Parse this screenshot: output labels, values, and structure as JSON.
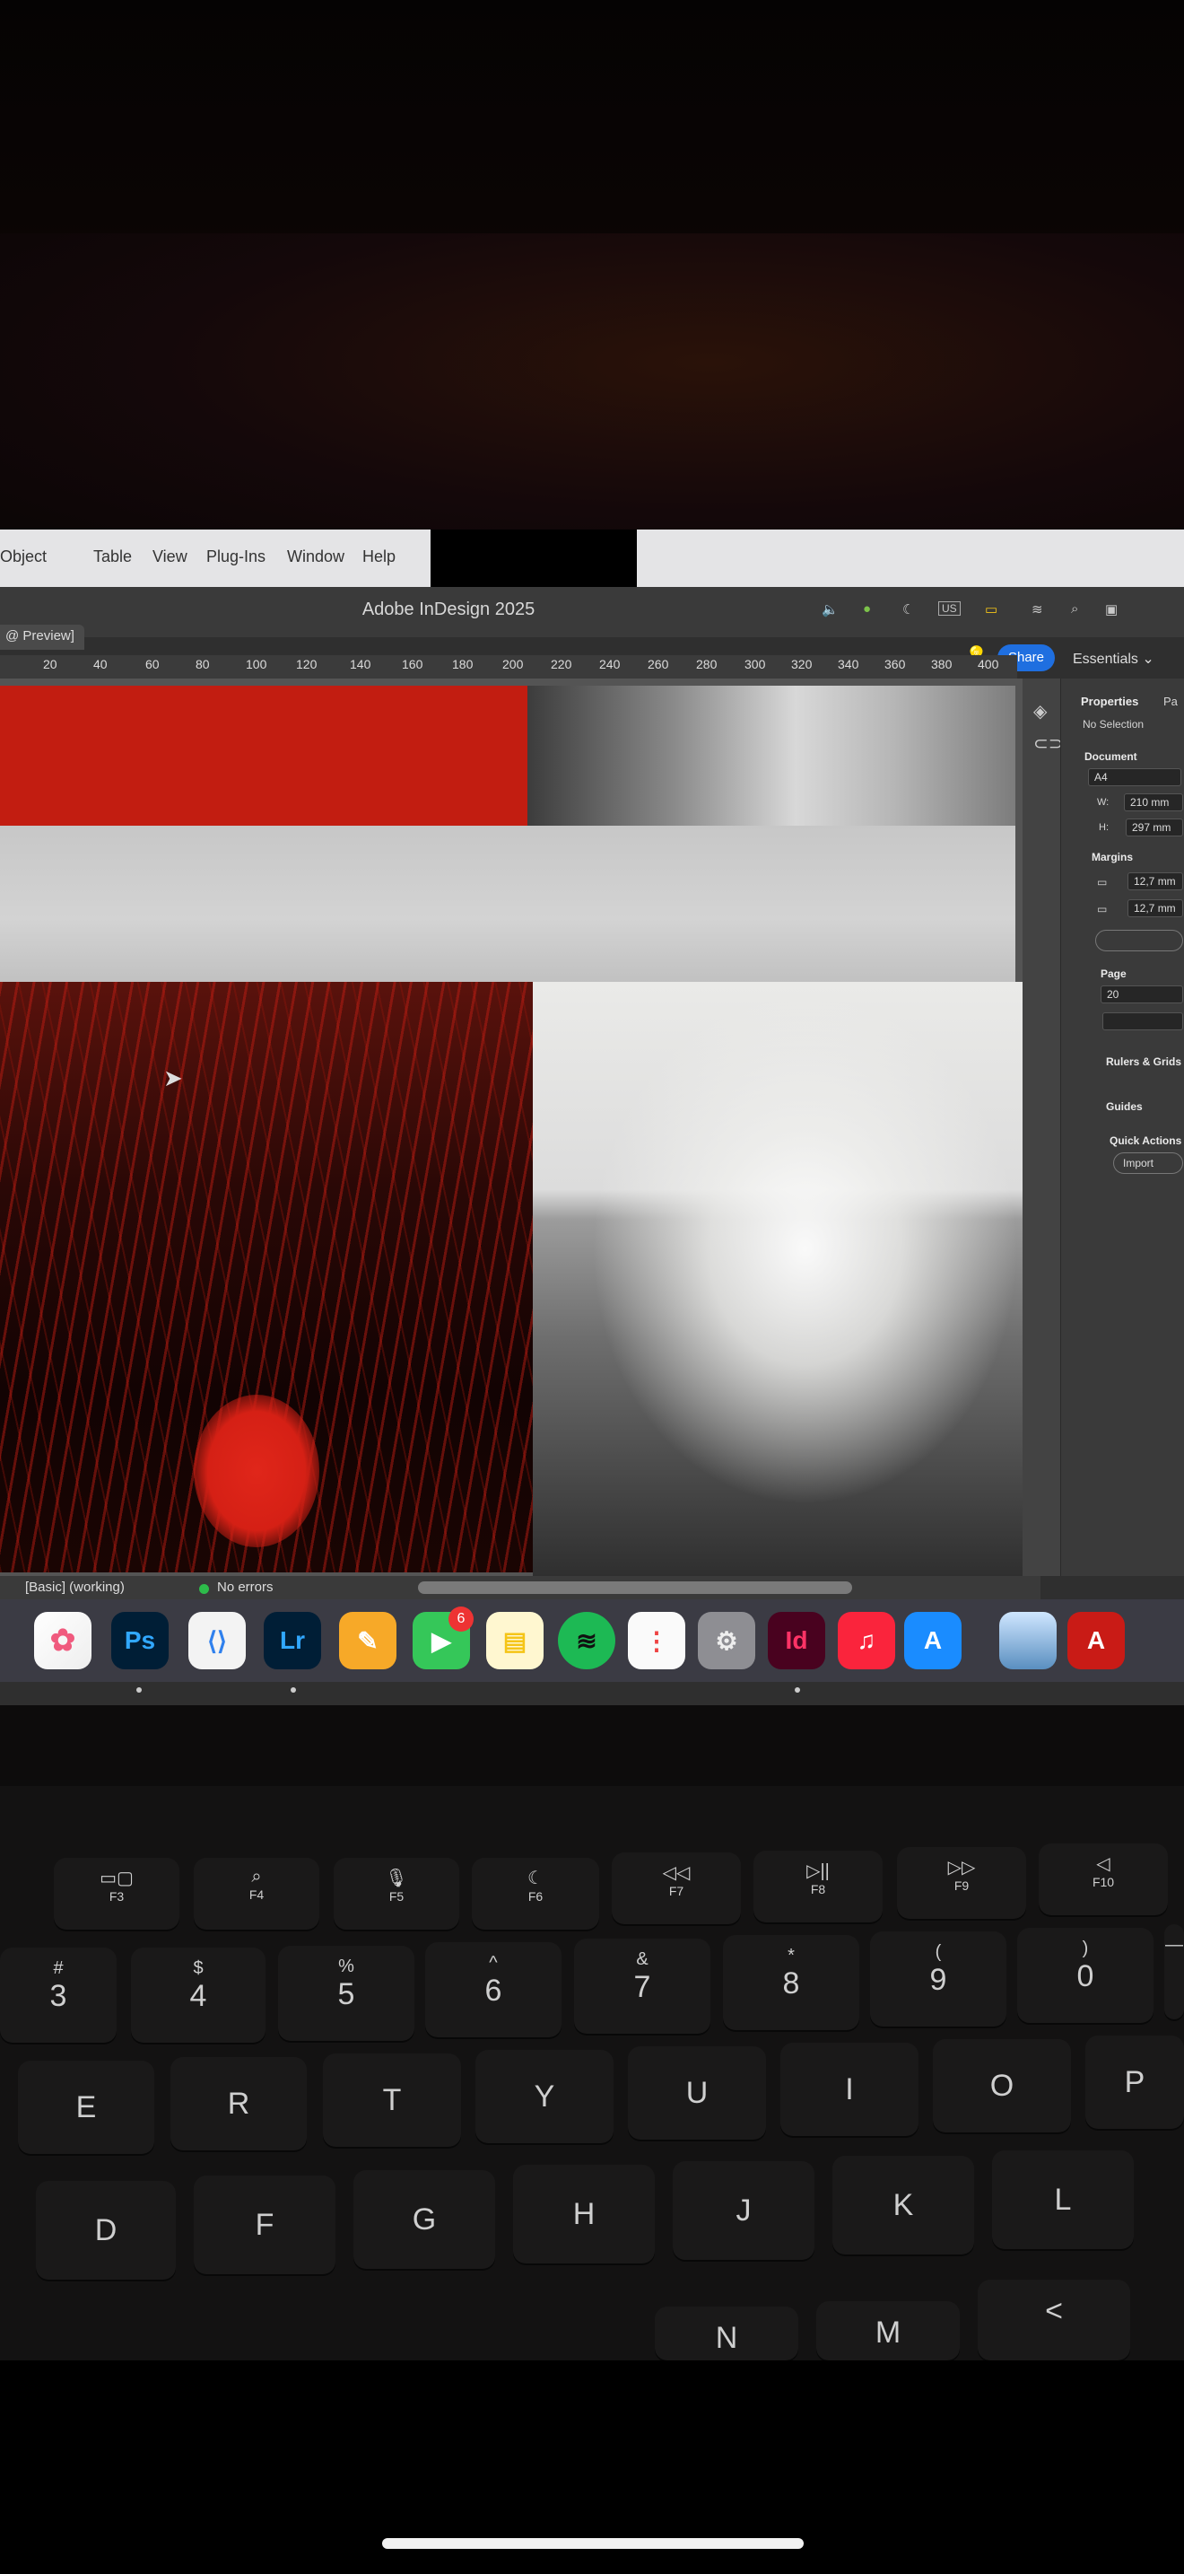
{
  "menubar": {
    "items": [
      "Object",
      "Table",
      "View",
      "Plug-Ins",
      "Window",
      "Help"
    ],
    "status_icons": [
      "volume-icon",
      "android-icon",
      "moon-icon",
      "battery-icon",
      "wifi-icon",
      "search-icon",
      "control-center-icon"
    ],
    "input_source": "US"
  },
  "window": {
    "title": "Adobe InDesign 2025",
    "doc_tab": "@ Preview]",
    "share_label": "Share",
    "workspace_label": "Essentials"
  },
  "ruler": {
    "ticks": [
      "20",
      "40",
      "60",
      "80",
      "100",
      "120",
      "140",
      "160",
      "180",
      "200",
      "220",
      "240",
      "260",
      "280",
      "300",
      "320",
      "340",
      "360",
      "380",
      "400"
    ]
  },
  "status_bar": {
    "profile": "[Basic] (working)",
    "errors": "No errors"
  },
  "properties_panel": {
    "tab_active": "Properties",
    "tab_other": "Pa",
    "selection": "No Selection",
    "document_label": "Document",
    "page_size": "A4",
    "width_label": "W:",
    "width": "210 mm",
    "height_label": "H:",
    "height": "297 mm",
    "margins_label": "Margins",
    "margin_top": "12,7 mm",
    "margin_bottom": "12,7 mm",
    "page_label": "Page",
    "page_value": "20",
    "rulers_grids": "Rulers & Grids",
    "guides": "Guides",
    "quick_actions": "Quick Actions",
    "import_label": "Import"
  },
  "dock": {
    "apps": [
      {
        "name": "Photos",
        "label": ""
      },
      {
        "name": "Photoshop",
        "label": "Ps"
      },
      {
        "name": "Visual Studio Code",
        "label": ""
      },
      {
        "name": "Lightroom",
        "label": "Lr"
      },
      {
        "name": "Pages",
        "label": ""
      },
      {
        "name": "FaceTime",
        "label": ""
      },
      {
        "name": "Notes",
        "label": ""
      },
      {
        "name": "Spotify",
        "label": ""
      },
      {
        "name": "Reminders",
        "label": ""
      },
      {
        "name": "System Settings",
        "label": ""
      },
      {
        "name": "InDesign",
        "label": "Id"
      },
      {
        "name": "Music",
        "label": ""
      },
      {
        "name": "App Store",
        "label": ""
      },
      {
        "name": "Preview",
        "label": ""
      },
      {
        "name": "Acrobat",
        "label": ""
      }
    ],
    "badge": "6"
  },
  "keyboard": {
    "fkeys": [
      {
        "icon": "▭▢",
        "name": "F3"
      },
      {
        "icon": "⌕",
        "name": "F4"
      },
      {
        "icon": "🎙",
        "name": "F5"
      },
      {
        "icon": "☾",
        "name": "F6"
      },
      {
        "icon": "◁◁",
        "name": "F7"
      },
      {
        "icon": "▷||",
        "name": "F8"
      },
      {
        "icon": "▷▷",
        "name": "F9"
      },
      {
        "icon": "◁",
        "name": "F10"
      }
    ],
    "number_row": [
      {
        "top": "#",
        "main": "3"
      },
      {
        "top": "$",
        "main": "4"
      },
      {
        "top": "%",
        "main": "5"
      },
      {
        "top": "^",
        "main": "6"
      },
      {
        "top": "&",
        "main": "7"
      },
      {
        "top": "*",
        "main": "8"
      },
      {
        "top": "(",
        "main": "9"
      },
      {
        "top": ")",
        "main": "0"
      },
      {
        "top": "—",
        "main": ""
      }
    ],
    "top_row": [
      "E",
      "R",
      "T",
      "Y",
      "U",
      "I",
      "O",
      "P"
    ],
    "home_row": [
      "D",
      "F",
      "G",
      "H",
      "J",
      "K",
      "L"
    ],
    "bottom_row": [
      "N",
      "M",
      "<"
    ]
  }
}
